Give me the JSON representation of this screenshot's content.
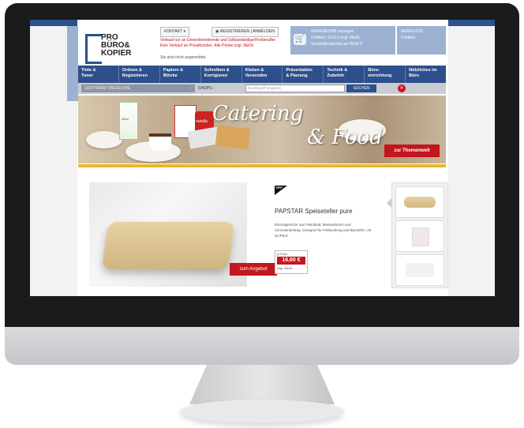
{
  "logo": {
    "text": "PRO\nBÜRO&\nKOPIER"
  },
  "header": {
    "kontakt": "KONTAKT",
    "register_login": "REGISTRIEREN | ANMELDEN",
    "notice": "Verkauf nur an Gewerbetreibende und Selbstständige/Freiberufler. Kein Verkauf an Privatkunden. Alle Preise zzgl. MwSt.",
    "not_logged_in": "Sie sind nicht angemeldet."
  },
  "cart": {
    "title": "WARENKORB anzeigen",
    "items": "0 Artikel | 0,00 € zzgl. MwSt.",
    "free_shipping": "Versandkostenfrei ab 49,00 €"
  },
  "wishlist": {
    "title": "MERKLISTE",
    "count": "0 Artikel"
  },
  "nav": [
    "Tinte &\nToner",
    "Ordnen &\nRegistrieren",
    "Papiere &\nBlöcke",
    "Schreiben &\nKorrigieren",
    "Kleben &\nVersenden",
    "Präsentation\n& Planung",
    "Technik &\nZubehör",
    "Büro-\neinrichtung",
    "Nützliches im\nBüro"
  ],
  "search": {
    "category_label": "SORTIMENTSBEREICHE",
    "shops_label": "SHOPS",
    "placeholder": "Suchbegriff eingeben",
    "button": "SUCHEN"
  },
  "banner": {
    "title_1": "Catering",
    "title_2": "& Food",
    "button": "zur Themenwelt",
    "milk_label": "Milch",
    "nutella_label": "nutella"
  },
  "product": {
    "flag": "TIPP",
    "title": "PAPSTAR Speiseteller pure",
    "description": "Einmalgeschirr aus Palmblatt, Massenbruch und Vorzeitenbeitrag. Geeignet für Fettkochung und Backöfen. 20 St./Pack.",
    "price_unit": "je Pack",
    "price": "16,60 €",
    "vat": "zzgl. MwSt.",
    "offer_button": "zum Angebot"
  },
  "colors": {
    "brand_blue": "#2d4f8b",
    "light_blue": "#9db1d2",
    "accent_red": "#c3161d",
    "accent_yellow": "#e9b52c"
  }
}
